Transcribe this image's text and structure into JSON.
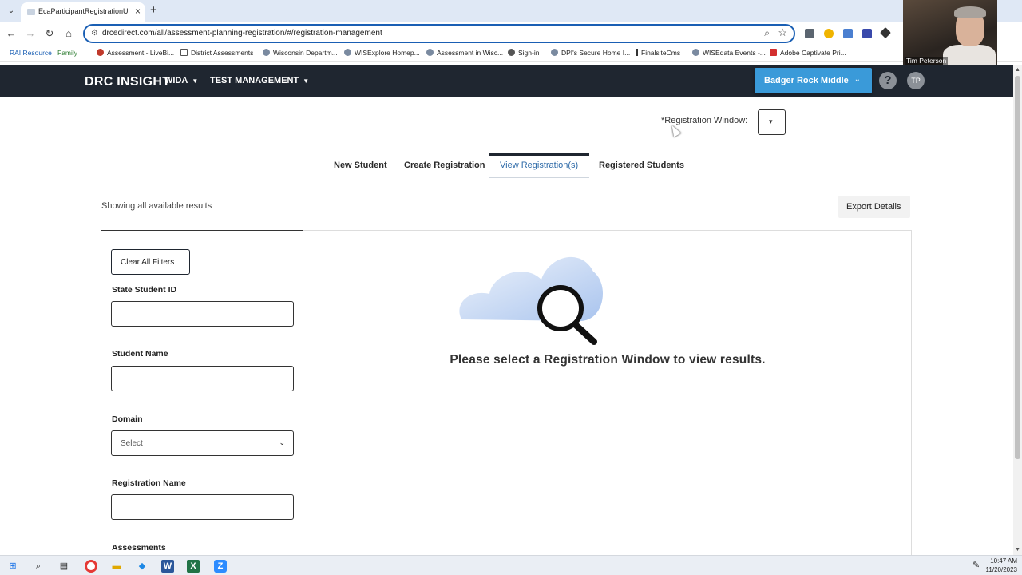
{
  "browser": {
    "tab_title": "EcaParticipantRegistrationUi",
    "url": "drcedirect.com/all/assessment-planning-registration/#/registration-management",
    "bookmarks": [
      "RAI Resource",
      "Family",
      "Assessment - LiveBi...",
      "District Assessments",
      "Wisconsin Departm...",
      "WISExplore Homep...",
      "Assessment in Wisc...",
      "Sign-in",
      "DPI's Secure Home I...",
      "FinalsiteCms",
      "WISEdata Events -...",
      "Adobe Captivate Pri..."
    ]
  },
  "webcam": {
    "name": "Tim Peterson"
  },
  "app": {
    "logo": "DRC INSIGHT",
    "menu": [
      "WIDA",
      "TEST MANAGEMENT"
    ],
    "org": "Badger Rock Middle",
    "avatar_initials": "TP",
    "help": "?"
  },
  "registration_window": {
    "label": "*Registration Window:"
  },
  "tabs": [
    {
      "label": "New Student"
    },
    {
      "label": "Create Registration"
    },
    {
      "label": "View Registration(s)"
    },
    {
      "label": "Registered Students"
    }
  ],
  "results": {
    "showing": "Showing all available results",
    "export_label": "Export Details",
    "empty_message": "Please select a Registration Window to view results."
  },
  "filters": {
    "clear_label": "Clear All Filters",
    "state_student_id": "State Student ID",
    "student_name": "Student Name",
    "domain": "Domain",
    "domain_value": "Select",
    "registration_name": "Registration Name",
    "assessments": "Assessments"
  },
  "taskbar": {
    "time": "10:47 AM",
    "date": "11/20/2023"
  },
  "colors": {
    "nav_bg": "#1f2630",
    "org_button": "#3a9ad9",
    "active_tab": "#2d6aa8"
  }
}
